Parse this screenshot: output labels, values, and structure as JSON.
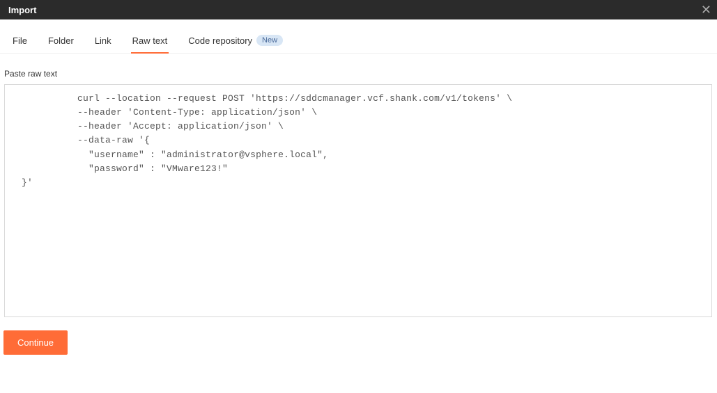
{
  "title": "Import",
  "close_icon_text": "✕",
  "tabs": [
    {
      "label": "File"
    },
    {
      "label": "Folder"
    },
    {
      "label": "Link"
    },
    {
      "label": "Raw text"
    },
    {
      "label": "Code repository",
      "badge": "New"
    }
  ],
  "form": {
    "label": "Paste raw text",
    "value": "            curl --location --request POST 'https://sddcmanager.vcf.shank.com/v1/tokens' \\\n            --header 'Content-Type: application/json' \\\n            --header 'Accept: application/json' \\\n            --data-raw '{\n              \"username\" : \"administrator@vsphere.local\",\n              \"password\" : \"VMware123!\"\n  }'"
  },
  "button": {
    "label": "Continue"
  }
}
